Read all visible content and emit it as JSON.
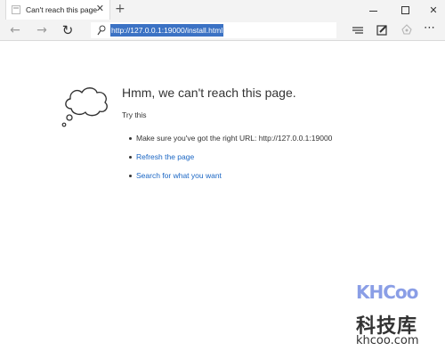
{
  "tab": {
    "title": "Can't reach this page",
    "close_glyph": "✕",
    "new_tab_glyph": "+"
  },
  "window_controls": {
    "close_glyph": "✕"
  },
  "toolbar": {
    "back_glyph": "←",
    "forward_glyph": "→",
    "refresh_glyph": "↻",
    "url": "http://127.0.0.1:19000/install.html",
    "more_glyph": "⋯"
  },
  "page": {
    "title": "Hmm, we can't reach this page.",
    "try_this": "Try this",
    "suggestions": [
      {
        "text": "Make sure you've got the right URL: http://127.0.0.1:19000",
        "link": false
      },
      {
        "text": "Refresh the page",
        "link": true
      },
      {
        "text": "Search for what you want",
        "link": true
      }
    ]
  },
  "watermark": {
    "logo_text": "KHCoo",
    "chinese": "科技库",
    "domain": "khcoo.com"
  },
  "icons": {
    "tab": "page-icon",
    "cloud": "thought-cloud-icon",
    "search": "search-icon",
    "hub": "hub-icon",
    "note": "web-note-icon",
    "share": "share-icon"
  },
  "colors": {
    "link": "#1a66c4",
    "url_highlight": "#3b72c4",
    "chrome": "#f3f3f3"
  }
}
